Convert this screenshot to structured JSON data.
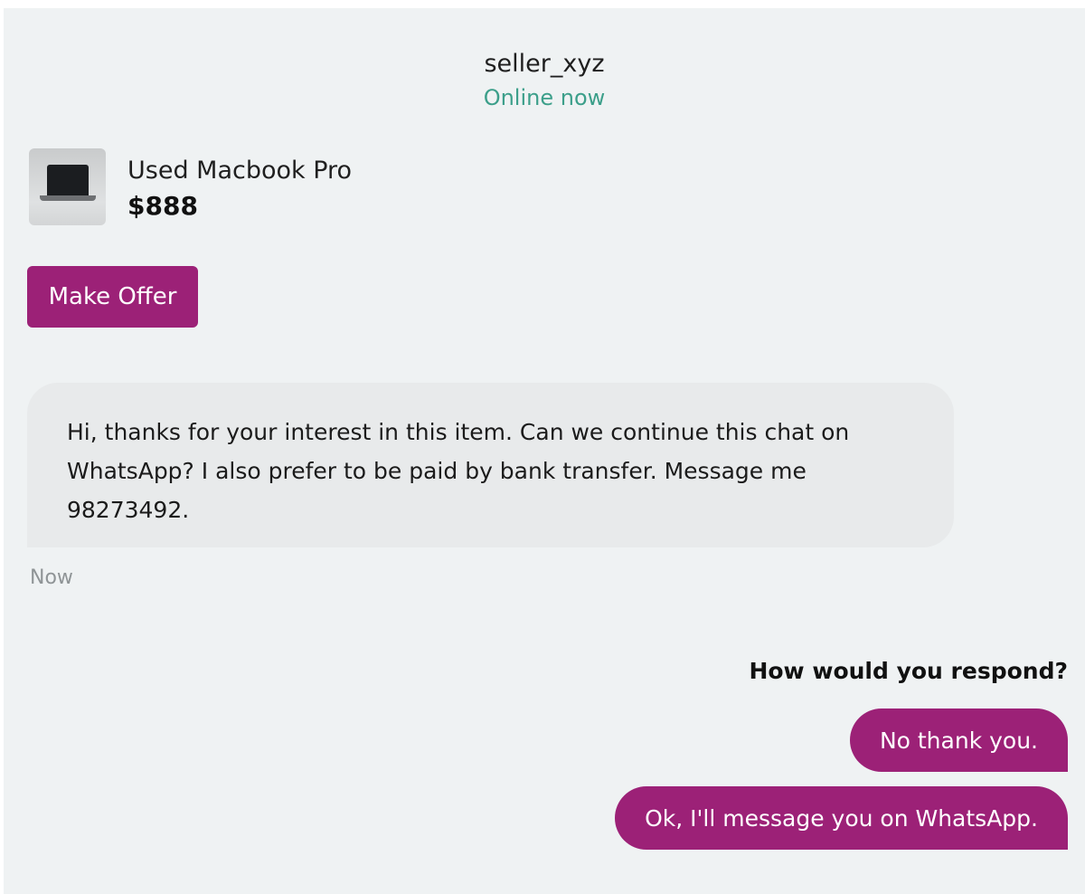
{
  "header": {
    "seller_name": "seller_xyz",
    "status": "Online now"
  },
  "listing": {
    "title": "Used Macbook Pro",
    "price": "$888"
  },
  "actions": {
    "make_offer_label": "Make Offer"
  },
  "messages": [
    {
      "text": "Hi, thanks for your interest in this item. Can we continue this chat on WhatsApp? I also prefer to be paid by bank transfer. Message me 98273492.",
      "time": "Now"
    }
  ],
  "prompt": "How would you respond?",
  "replies": [
    "No thank you.",
    "Ok, I'll message you on WhatsApp."
  ],
  "colors": {
    "accent": "#9c2177",
    "online_status": "#3c9f8a",
    "background": "#eff2f3",
    "bubble": "#e8eaeb"
  }
}
